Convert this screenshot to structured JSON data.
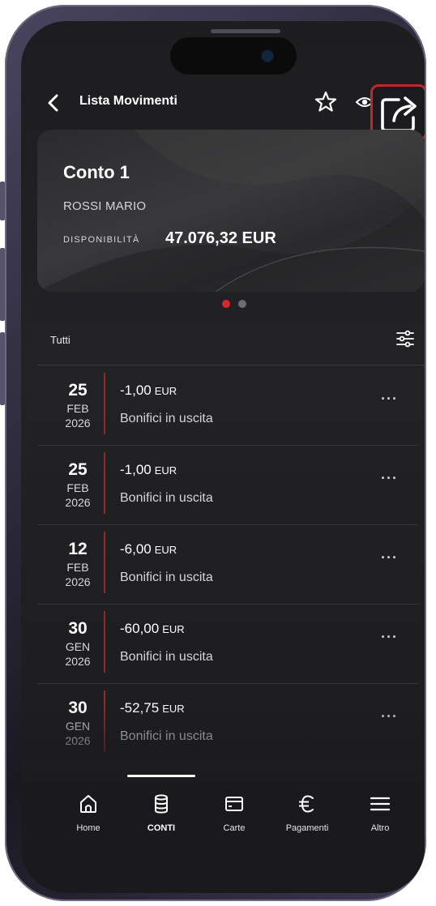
{
  "header": {
    "title": "Lista Movimenti",
    "back_icon": "chevron-left-icon",
    "favorite_icon": "star-icon",
    "visibility_icon": "eye-icon",
    "share_icon": "share-export-icon"
  },
  "account_card": {
    "name": "Conto 1",
    "holder": "ROSSI MARIO",
    "available_label": "DISPONIBILITÀ",
    "available_amount": "47.076,32 EUR"
  },
  "pager": {
    "count": 2,
    "active_index": 0
  },
  "filter": {
    "label": "Tutti",
    "icon": "sliders-icon"
  },
  "transactions": [
    {
      "day": "25",
      "month": "FEB",
      "year": "2026",
      "amount": "-1,00",
      "currency": "EUR",
      "description": "Bonifici in uscita",
      "more": "···"
    },
    {
      "day": "25",
      "month": "FEB",
      "year": "2026",
      "amount": "-1,00",
      "currency": "EUR",
      "description": "Bonifici in uscita",
      "more": "···"
    },
    {
      "day": "12",
      "month": "FEB",
      "year": "2026",
      "amount": "-6,00",
      "currency": "EUR",
      "description": "Bonifici in uscita",
      "more": "···"
    },
    {
      "day": "30",
      "month": "GEN",
      "year": "2026",
      "amount": "-60,00",
      "currency": "EUR",
      "description": "Bonifici in uscita",
      "more": "···"
    },
    {
      "day": "30",
      "month": "GEN",
      "year": "2026",
      "amount": "-52,75",
      "currency": "EUR",
      "description": "Bonifici in uscita",
      "more": "···"
    }
  ],
  "nav": {
    "items": [
      {
        "label": "Home",
        "icon": "home-icon",
        "active": false
      },
      {
        "label": "CONTI",
        "icon": "database-icon",
        "active": true
      },
      {
        "label": "Carte",
        "icon": "card-icon",
        "active": false
      },
      {
        "label": "Pagamenti",
        "icon": "euro-icon",
        "active": false
      },
      {
        "label": "Altro",
        "icon": "menu-icon",
        "active": false
      }
    ]
  },
  "colors": {
    "accent": "#c0272d",
    "background": "#1d1d1f",
    "text": "#ffffff",
    "date_bar": "#8e2a2a"
  }
}
